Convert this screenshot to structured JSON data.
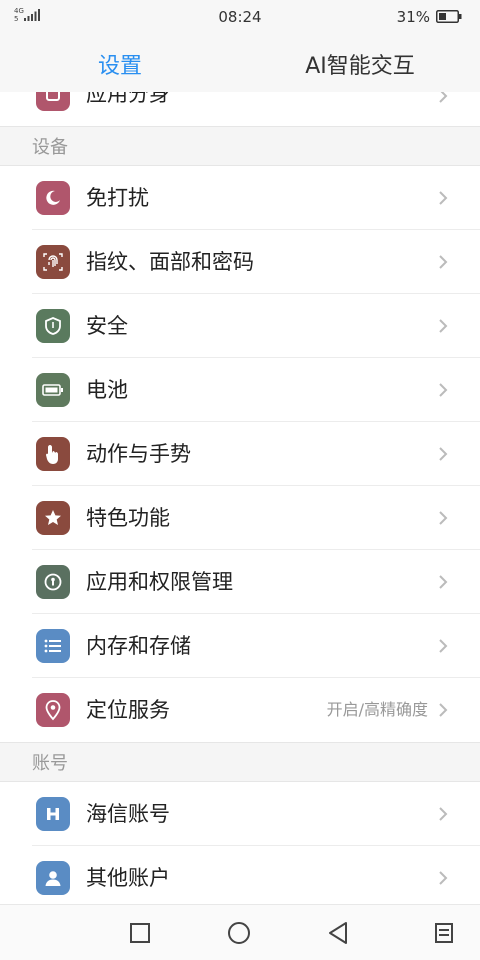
{
  "status_bar": {
    "network": "4G",
    "network_sub": "5",
    "time": "08:24",
    "battery_percent": "31%"
  },
  "tabs": [
    {
      "label": "设置",
      "active": true
    },
    {
      "label": "AI智能交互",
      "active": false
    }
  ],
  "partial_item": {
    "label": "应用分身",
    "icon": "app-clone-icon",
    "color": "#b0566c"
  },
  "sections": [
    {
      "header": "设备",
      "items": [
        {
          "label": "免打扰",
          "icon": "moon-icon",
          "color": "#b0566c",
          "value": ""
        },
        {
          "label": "指纹、面部和密码",
          "icon": "fingerprint-icon",
          "color": "#8a4a3e",
          "value": ""
        },
        {
          "label": "安全",
          "icon": "shield-icon",
          "color": "#5a7a5e",
          "value": ""
        },
        {
          "label": "电池",
          "icon": "battery-icon",
          "color": "#5f7a5e",
          "value": ""
        },
        {
          "label": "动作与手势",
          "icon": "hand-gesture-icon",
          "color": "#8a4a3e",
          "value": ""
        },
        {
          "label": "特色功能",
          "icon": "star-icon",
          "color": "#8a4a3e",
          "value": ""
        },
        {
          "label": "应用和权限管理",
          "icon": "permission-icon",
          "color": "#5a7060",
          "value": ""
        },
        {
          "label": "内存和存储",
          "icon": "list-icon",
          "color": "#5a8cc4",
          "value": ""
        },
        {
          "label": "定位服务",
          "icon": "location-pin-icon",
          "color": "#b0566c",
          "value": "开启/高精确度"
        }
      ]
    },
    {
      "header": "账号",
      "items": [
        {
          "label": "海信账号",
          "icon": "hisense-h-icon",
          "color": "#5a8cc4",
          "value": ""
        },
        {
          "label": "其他账户",
          "icon": "person-icon",
          "color": "#5a8cc4",
          "value": ""
        }
      ]
    }
  ]
}
